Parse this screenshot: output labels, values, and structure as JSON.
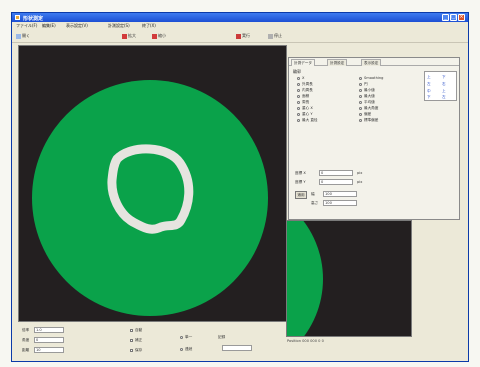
{
  "window": {
    "title": "形状測定"
  },
  "menu": [
    "ファイル(F)",
    "編集(E)",
    "表示設定(V)",
    "計測設定(S)",
    "終了(X)"
  ],
  "toolbar": {
    "left_label": "開く",
    "center_labels": [
      "拡大",
      "縮小"
    ],
    "right_labels": [
      "実行",
      "停止"
    ]
  },
  "viewport": {
    "background": "#231f20",
    "disk_color": "#0aa24a",
    "ring_color": "#e6e4df"
  },
  "panel": {
    "tabs": [
      "計測データ",
      "計測設定",
      "表示設定"
    ],
    "group_label": "輪郭",
    "options_left": [
      "X",
      "外周長",
      "内周長",
      "面積",
      "周長",
      "重心 X",
      "重心 Y",
      "最大 直径"
    ],
    "options_right": [
      "Smoothing",
      "円",
      "最小値",
      "最大値",
      "平均値",
      "最大角度",
      "偏差",
      "標準偏差"
    ],
    "position_options": [
      "上",
      "下",
      "左",
      "右",
      "中",
      "上",
      "下",
      "左"
    ],
    "rows": [
      {
        "label": "座標 X",
        "value": "0",
        "unit": "pix"
      },
      {
        "label": "座標 Y",
        "value": "0",
        "unit": "pix"
      },
      {
        "label": "幅",
        "value": "100",
        "unit": ""
      },
      {
        "label": "高さ",
        "value": "100",
        "unit": ""
      }
    ],
    "apply_label": "適用"
  },
  "bottom": {
    "rows": [
      {
        "label": "倍率",
        "value": "1.0"
      },
      {
        "label": "角度",
        "value": "0"
      },
      {
        "label": "距離",
        "value": "10"
      }
    ],
    "checks": [
      "自動",
      "補正",
      "保存"
    ],
    "radios": [
      "単一",
      "連続"
    ],
    "extra_label": "記録",
    "extra_value": ""
  },
  "status": "Position 000 000   0 0"
}
